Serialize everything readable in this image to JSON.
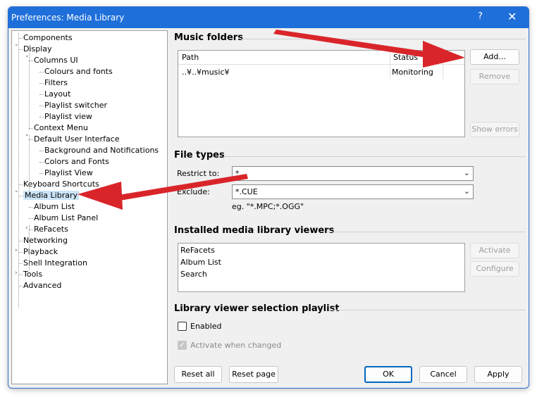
{
  "window": {
    "title": "Preferences: Media Library",
    "help_glyph": "?",
    "close_glyph": "✕"
  },
  "tree": [
    {
      "label": "Components",
      "level": 0,
      "expander": ""
    },
    {
      "label": "Display",
      "level": 0,
      "expander": "down"
    },
    {
      "label": "Columns UI",
      "level": 1,
      "expander": "down"
    },
    {
      "label": "Colours and fonts",
      "level": 2,
      "expander": ""
    },
    {
      "label": "Filters",
      "level": 2,
      "expander": ""
    },
    {
      "label": "Layout",
      "level": 2,
      "expander": ""
    },
    {
      "label": "Playlist switcher",
      "level": 2,
      "expander": ""
    },
    {
      "label": "Playlist view",
      "level": 2,
      "expander": ""
    },
    {
      "label": "Context Menu",
      "level": 1,
      "expander": ""
    },
    {
      "label": "Default User Interface",
      "level": 1,
      "expander": "down"
    },
    {
      "label": "Background and Notifications",
      "level": 2,
      "expander": ""
    },
    {
      "label": "Colors and Fonts",
      "level": 2,
      "expander": ""
    },
    {
      "label": "Playlist View",
      "level": 2,
      "expander": ""
    },
    {
      "label": "Keyboard Shortcuts",
      "level": 0,
      "expander": ""
    },
    {
      "label": "Media Library",
      "level": 0,
      "expander": "down",
      "selected": true
    },
    {
      "label": "Album List",
      "level": 1,
      "expander": ""
    },
    {
      "label": "Album List Panel",
      "level": 1,
      "expander": ""
    },
    {
      "label": "ReFacets",
      "level": 1,
      "expander": "right"
    },
    {
      "label": "Networking",
      "level": 0,
      "expander": ""
    },
    {
      "label": "Playback",
      "level": 0,
      "expander": "right"
    },
    {
      "label": "Shell Integration",
      "level": 0,
      "expander": ""
    },
    {
      "label": "Tools",
      "level": 0,
      "expander": "right"
    },
    {
      "label": "Advanced",
      "level": 0,
      "expander": ""
    }
  ],
  "music_folders": {
    "title": "Music folders",
    "col_path": "Path",
    "col_status": "Status",
    "rows": [
      {
        "path": "..¥..¥music¥",
        "status": "Monitoring"
      }
    ],
    "add": "Add...",
    "remove": "Remove",
    "show_errors": "Show errors"
  },
  "file_types": {
    "title": "File types",
    "restrict_label": "Restrict to:",
    "restrict_value": "*",
    "exclude_label": "Exclude:",
    "exclude_value": "*.CUE",
    "hint": "eg. \"*.MPC;*.OGG\""
  },
  "viewers": {
    "title": "Installed media library viewers",
    "items": [
      "ReFacets",
      "Album List",
      "Search"
    ],
    "activate": "Activate",
    "configure": "Configure"
  },
  "selection_playlist": {
    "title": "Library viewer selection playlist",
    "enabled_label": "Enabled",
    "activate_label": "Activate when changed"
  },
  "footer": {
    "reset_all": "Reset all",
    "reset_page": "Reset page",
    "ok": "OK",
    "cancel": "Cancel",
    "apply": "Apply"
  },
  "colors": {
    "titlebar": "#1e6fd9",
    "annotation_arrow": "#d9252a",
    "selection": "#cce4f7"
  },
  "icons": {
    "expander_down": "chevron-down-icon",
    "expander_right": "chevron-right-icon",
    "combo": "chevron-down-icon"
  }
}
